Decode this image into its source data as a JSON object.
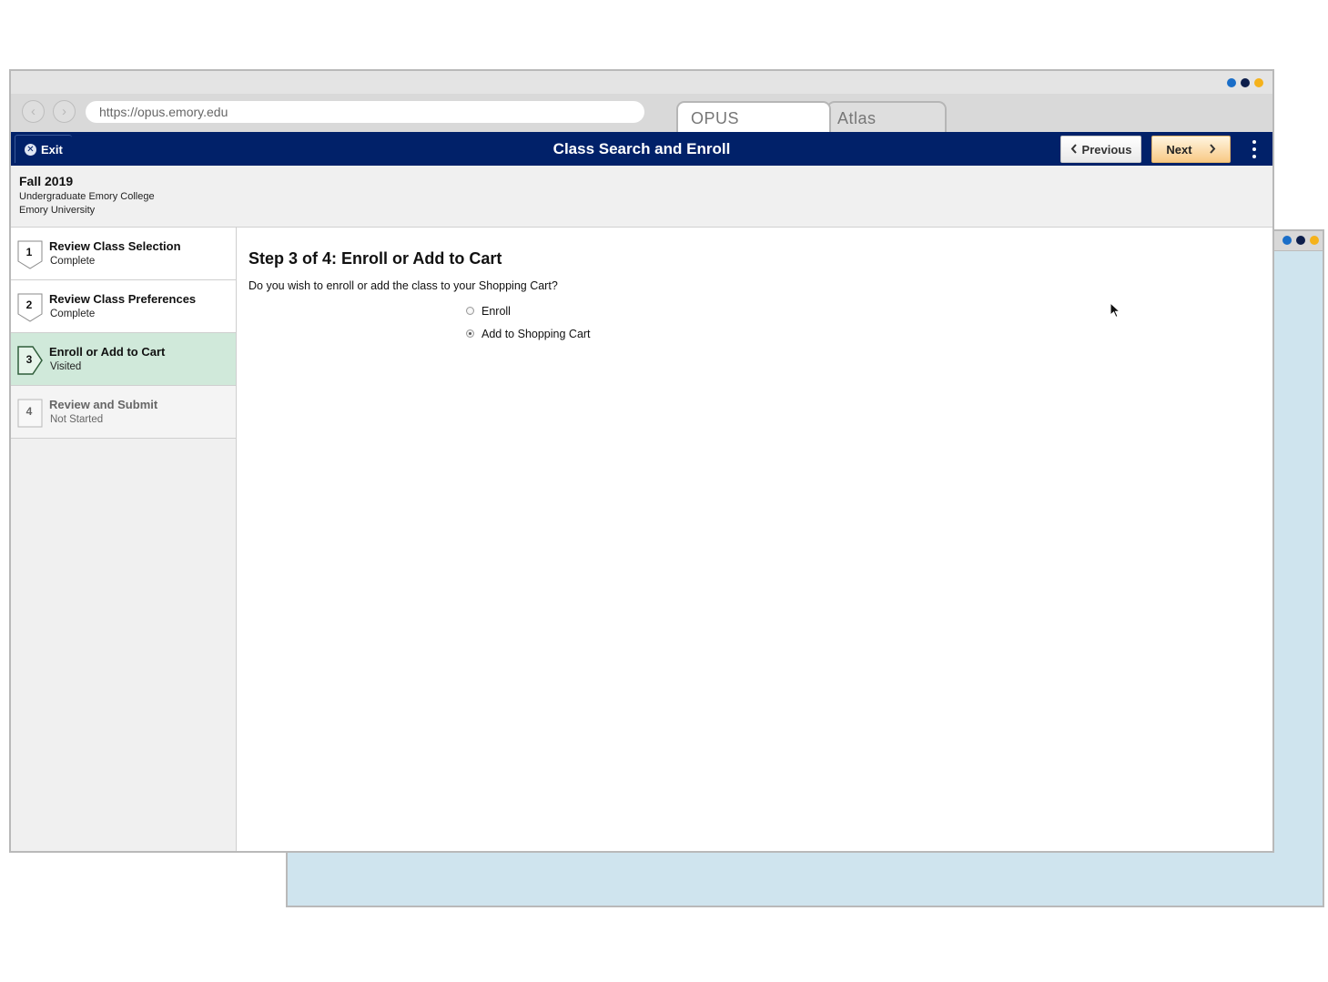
{
  "window_controls": {
    "colors": [
      "#1a6ec8",
      "#0d1f4c",
      "#f5b21b"
    ]
  },
  "browser": {
    "url": "https://opus.emory.edu",
    "tabs": [
      {
        "label": "OPUS",
        "active": true
      },
      {
        "label": "Atlas",
        "active": false
      }
    ]
  },
  "header": {
    "exit_label": "Exit",
    "title": "Class Search and Enroll",
    "previous_label": "Previous",
    "next_label": "Next",
    "brand_color": "#012169"
  },
  "term": {
    "title": "Fall 2019",
    "career": "Undergraduate Emory College",
    "institution": "Emory University"
  },
  "steps": [
    {
      "number": "1",
      "label": "Review Class Selection",
      "status": "Complete"
    },
    {
      "number": "2",
      "label": "Review Class Preferences",
      "status": "Complete"
    },
    {
      "number": "3",
      "label": "Enroll or Add to Cart",
      "status": "Visited"
    },
    {
      "number": "4",
      "label": "Review and Submit",
      "status": "Not Started"
    }
  ],
  "main": {
    "heading": "Step 3 of 4: Enroll or Add to Cart",
    "question": "Do you wish to enroll or add the class to your Shopping Cart?",
    "options": [
      {
        "label": "Enroll",
        "selected": false
      },
      {
        "label": "Add to Shopping Cart",
        "selected": true
      }
    ]
  }
}
